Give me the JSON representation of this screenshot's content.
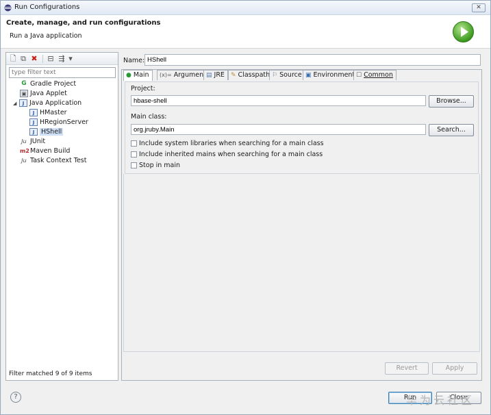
{
  "window": {
    "title": "Run Configurations",
    "close_glyph": "✕"
  },
  "header": {
    "title": "Create, manage, and run configurations",
    "subtitle": "Run a Java application"
  },
  "left": {
    "filter_placeholder": "type filter text",
    "tree": [
      {
        "label": "Gradle Project",
        "icon": "gradle-icon",
        "glyph": "G",
        "level": 0
      },
      {
        "label": "Java Applet",
        "icon": "applet-icon",
        "glyph": "▣",
        "level": 0
      },
      {
        "label": "Java Application",
        "icon": "java-app-icon",
        "glyph": "J",
        "level": 0,
        "expanded": true
      },
      {
        "label": "HMaster",
        "icon": "java-config-icon",
        "glyph": "J",
        "level": 1
      },
      {
        "label": "HRegionServer",
        "icon": "java-config-icon",
        "glyph": "J",
        "level": 1
      },
      {
        "label": "HShell",
        "icon": "java-config-icon",
        "glyph": "J",
        "level": 1,
        "selected": true
      },
      {
        "label": "JUnit",
        "icon": "junit-icon",
        "glyph": "Ju",
        "level": 0
      },
      {
        "label": "Maven Build",
        "icon": "maven-icon",
        "glyph": "m2",
        "level": 0
      },
      {
        "label": "Task Context Test",
        "icon": "task-context-icon",
        "glyph": "Ju",
        "level": 0
      }
    ],
    "filter_status": "Filter matched 9 of 9 items",
    "toolbar_glyphs": {
      "new": "🗋",
      "duplicate": "⧉",
      "delete": "✖",
      "collapse": "⊟",
      "filter": "⇶",
      "dropdown": "▾"
    }
  },
  "config": {
    "name_label": "Name:",
    "name_value": "HShell",
    "tabs": [
      {
        "label": "Main",
        "icon": "main-tab-icon",
        "glyph": "●",
        "active": true
      },
      {
        "label": "Arguments",
        "icon": "arguments-icon",
        "glyph": "(x)="
      },
      {
        "label": "JRE",
        "icon": "jre-icon",
        "glyph": "▤"
      },
      {
        "label": "Classpath",
        "icon": "classpath-icon",
        "glyph": "✎"
      },
      {
        "label": "Source",
        "icon": "source-icon",
        "glyph": "⚐"
      },
      {
        "label": "Environment",
        "icon": "environment-icon",
        "glyph": "▣"
      },
      {
        "label": "Common",
        "icon": "common-icon",
        "glyph": "☐"
      }
    ],
    "project_label": "Project:",
    "project_value": "hbase-shell",
    "browse_label": "Browse...",
    "main_class_label": "Main class:",
    "main_class_value": "org.jruby.Main",
    "search_label": "Search...",
    "checkboxes": [
      {
        "label": "Include system libraries when searching for a main class",
        "checked": false
      },
      {
        "label": "Include inherited mains when searching for a main class",
        "checked": false
      },
      {
        "label": "Stop in main",
        "checked": false
      }
    ],
    "revert_label": "Revert",
    "apply_label": "Apply"
  },
  "footer": {
    "help_glyph": "?",
    "run_label": "Run",
    "close_label": "Close",
    "watermark": "华为云社区"
  },
  "colors": {
    "accent": "#3c9a1e",
    "selection": "#cfe0f6"
  }
}
